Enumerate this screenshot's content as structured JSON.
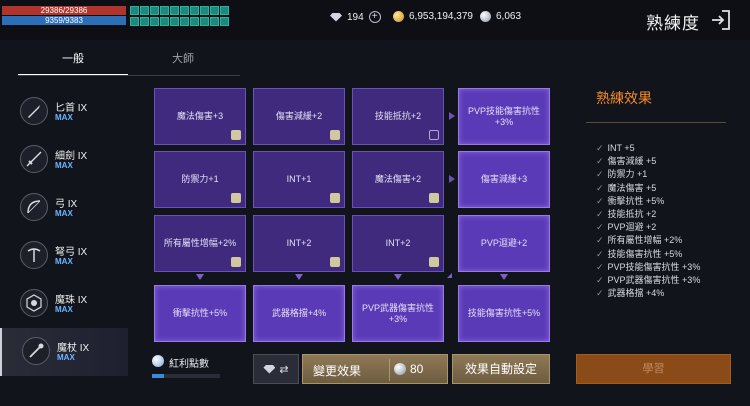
{
  "status": {
    "hp": "29386/29386",
    "hp_fill": 1.0,
    "mp": "9359/9383",
    "mp_fill": 0.997
  },
  "currencies": {
    "diamond": "194",
    "gold": "6,953,194,379",
    "silver": "6,063"
  },
  "page_title": "熟練度",
  "tabs": [
    {
      "label": "一般",
      "active": true
    },
    {
      "label": "大師",
      "active": false
    }
  ],
  "weapons": [
    {
      "name": "匕首 IX",
      "level": "MAX",
      "icon": "dagger-icon"
    },
    {
      "name": "細劍 IX",
      "level": "MAX",
      "icon": "rapier-icon"
    },
    {
      "name": "弓 IX",
      "level": "MAX",
      "icon": "bow-icon"
    },
    {
      "name": "弩弓 IX",
      "level": "MAX",
      "icon": "crossbow-icon"
    },
    {
      "name": "魔珠 IX",
      "level": "MAX",
      "icon": "orb-icon"
    },
    {
      "name": "魔杖 IX",
      "level": "MAX",
      "icon": "wand-icon"
    }
  ],
  "grid": [
    [
      "魔法傷害+3",
      "傷害減緩+2",
      "技能抵抗+2",
      "PVP技能傷害抗性+3%"
    ],
    [
      "防禦力+1",
      "INT+1",
      "魔法傷害+2",
      "傷害減緩+3"
    ],
    [
      "所有屬性增幅+2%",
      "INT+2",
      "INT+2",
      "PVP迴避+2"
    ],
    [
      "衝擊抗性+5%",
      "武器格擋+4%",
      "PVP武器傷害抗性+3%",
      "技能傷害抗性+5%"
    ]
  ],
  "bonus": {
    "label": "紅利點數",
    "fill": 0.18
  },
  "buttons": {
    "change_effect": "變更效果",
    "change_cost": "80",
    "auto_set": "效果自動設定",
    "learn": "學習"
  },
  "effects": {
    "title": "熟練效果",
    "items": [
      "INT +5",
      "傷害減緩 +5",
      "防禦力 +1",
      "魔法傷害 +5",
      "衝擊抗性 +5%",
      "技能抵抗 +2",
      "PVP迴避 +2",
      "所有屬性增幅 +2%",
      "技能傷害抗性 +5%",
      "PVP技能傷害抗性 +3%",
      "PVP武器傷害抗性 +3%",
      "武器格擋 +4%"
    ]
  },
  "colors": {
    "accent_orange": "#f38a2a",
    "max_blue": "#6fb6ff",
    "node_purple": "#3f2a7e",
    "node_active": "#5a3ab6"
  }
}
